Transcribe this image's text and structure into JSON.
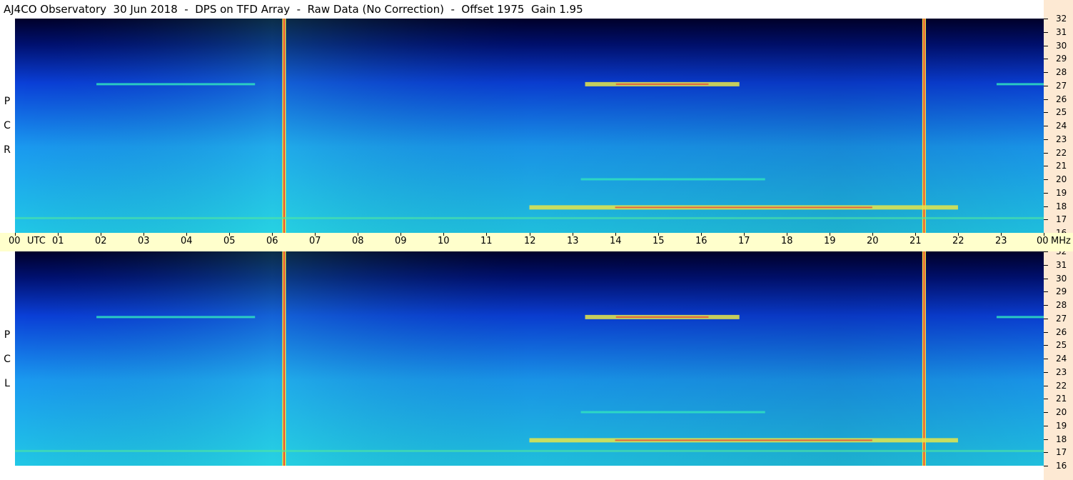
{
  "title": "AJ4CO Observatory  30 Jun 2018  -  DPS on TFD Array  -  Raw Data (No Correction)  -  Offset 1975  Gain 1.95",
  "panels": [
    {
      "id": "rcp",
      "label": [
        "R",
        "C",
        "P"
      ]
    },
    {
      "id": "lcp",
      "label": [
        "L",
        "C",
        "P"
      ]
    }
  ],
  "freq_ticks": [
    "32",
    "31",
    "30",
    "29",
    "28",
    "27",
    "26",
    "25",
    "24",
    "23",
    "22",
    "21",
    "20",
    "19",
    "18",
    "17",
    "16"
  ],
  "time_ticks": [
    "00",
    "01",
    "02",
    "03",
    "04",
    "05",
    "06",
    "07",
    "08",
    "09",
    "10",
    "11",
    "12",
    "13",
    "14",
    "15",
    "16",
    "17",
    "18",
    "19",
    "20",
    "21",
    "22",
    "23",
    "00"
  ],
  "time_unit": "UTC",
  "freq_unit": "MHz",
  "colors": {
    "background_top": "#00002a",
    "mid_blue": "#0a3fd8",
    "light_blue": "#1a9af0",
    "cyan": "#21c8e6",
    "band_yellow": "#e6e64a",
    "band_red": "#e84a3a",
    "axis_bg": "#fde9d3",
    "time_bar_bg": "#ffffcc"
  },
  "chart_data": {
    "type": "heatmap",
    "title": "AJ4CO Observatory  30 Jun 2018  -  DPS on TFD Array  -  Raw Data (No Correction)  -  Offset 1975  Gain 1.95",
    "x_axis": {
      "label": "UTC",
      "range": [
        0,
        24
      ],
      "ticks": [
        "00",
        "01",
        "02",
        "03",
        "04",
        "05",
        "06",
        "07",
        "08",
        "09",
        "10",
        "11",
        "12",
        "13",
        "14",
        "15",
        "16",
        "17",
        "18",
        "19",
        "20",
        "21",
        "22",
        "23",
        "00"
      ]
    },
    "y_axis": {
      "label": "MHz",
      "range": [
        16,
        32
      ],
      "ticks": [
        16,
        17,
        18,
        19,
        20,
        21,
        22,
        23,
        24,
        25,
        26,
        27,
        28,
        29,
        30,
        31,
        32
      ]
    },
    "panels": [
      "RCP",
      "LCP"
    ],
    "colormap": "jet",
    "features": [
      {
        "kind": "vertical_line",
        "time_utc": 6.27
      },
      {
        "kind": "vertical_line",
        "time_utc": 21.2
      },
      {
        "kind": "band",
        "freq_mhz": 27.1,
        "time_utc": [
          13.3,
          16.9
        ],
        "intensity": "high"
      },
      {
        "kind": "band",
        "freq_mhz": 27.1,
        "time_utc": [
          1.9,
          5.6
        ],
        "intensity": "medium"
      },
      {
        "kind": "band",
        "freq_mhz": 27.1,
        "time_utc": [
          22.9,
          24
        ],
        "intensity": "medium"
      },
      {
        "kind": "band",
        "freq_mhz": 17.9,
        "time_utc": [
          12,
          22
        ],
        "intensity": "high"
      },
      {
        "kind": "band",
        "freq_mhz": 20.0,
        "time_utc": [
          13.2,
          17.5
        ],
        "intensity": "medium"
      },
      {
        "kind": "band",
        "freq_mhz": 17.1,
        "time_utc": [
          0,
          24
        ],
        "intensity": "low"
      }
    ]
  }
}
